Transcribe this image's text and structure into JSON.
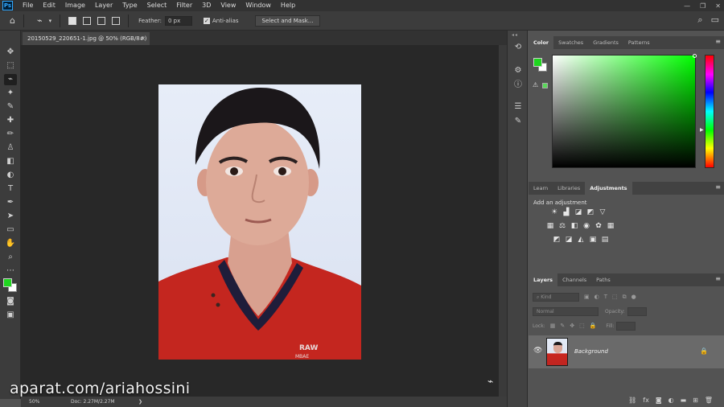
{
  "menu": {
    "items": [
      "File",
      "Edit",
      "Image",
      "Layer",
      "Type",
      "Select",
      "Filter",
      "3D",
      "View",
      "Window",
      "Help"
    ],
    "logo": "Ps"
  },
  "options": {
    "feather_label": "Feather:",
    "feather_value": "0 px",
    "antialias_label": "Anti-alias",
    "select_mask_label": "Select and Mask..."
  },
  "document": {
    "tab_title": "20150529_220651-1.jpg @ 50% (RGB/8#)",
    "zoom": "50%",
    "doc_size": "Doc: 2.27M/2.27M"
  },
  "color_panel": {
    "tabs": [
      "Color",
      "Swatches",
      "Gradients",
      "Patterns"
    ],
    "foreground": "#1fd41f",
    "background": "#ffffff"
  },
  "adjustments_panel": {
    "tabs": [
      "Learn",
      "Libraries",
      "Adjustments"
    ],
    "title": "Add an adjustment"
  },
  "layers_panel": {
    "tabs": [
      "Layers",
      "Channels",
      "Paths"
    ],
    "kind_placeholder": "Kind",
    "blend_mode": "Normal",
    "opacity_label": "Opacity:",
    "lock_label": "Lock:",
    "fill_label": "Fill:",
    "layer_name": "Background"
  },
  "watermark": "aparat.com/ariahossini"
}
